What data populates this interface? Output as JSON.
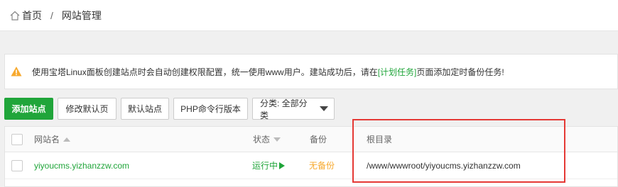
{
  "breadcrumb": {
    "home": "首页",
    "separator": "/",
    "current": "网站管理"
  },
  "notice": {
    "text_before": "使用宝塔Linux面板创建站点时会自动创建权限配置，统一使用www用户。建站成功后，请在",
    "link": "[计划任务]",
    "text_after": "页面添加定时备份任务!"
  },
  "toolbar": {
    "add_site": "添加站点",
    "edit_default_page": "修改默认页",
    "default_site": "默认站点",
    "php_cli_version": "PHP命令行版本",
    "category_select": "分类: 全部分类"
  },
  "table": {
    "headers": {
      "name": "网站名",
      "status": "状态",
      "backup": "备份",
      "root": "根目录"
    },
    "rows": [
      {
        "name": "yiyoucms.yizhanzzw.com",
        "status": "运行中",
        "backup": "无备份",
        "root": "/www/wwwroot/yiyoucms.yizhanzzw.com"
      }
    ]
  },
  "colors": {
    "accent": "#20a53a",
    "warning": "#f7a92e",
    "highlight_border": "#e53935"
  },
  "icons": {
    "home": "home-icon",
    "warning": "warning-icon",
    "dropdown": "caret-down-icon",
    "sort": "sort-icon",
    "play": "play-icon"
  }
}
